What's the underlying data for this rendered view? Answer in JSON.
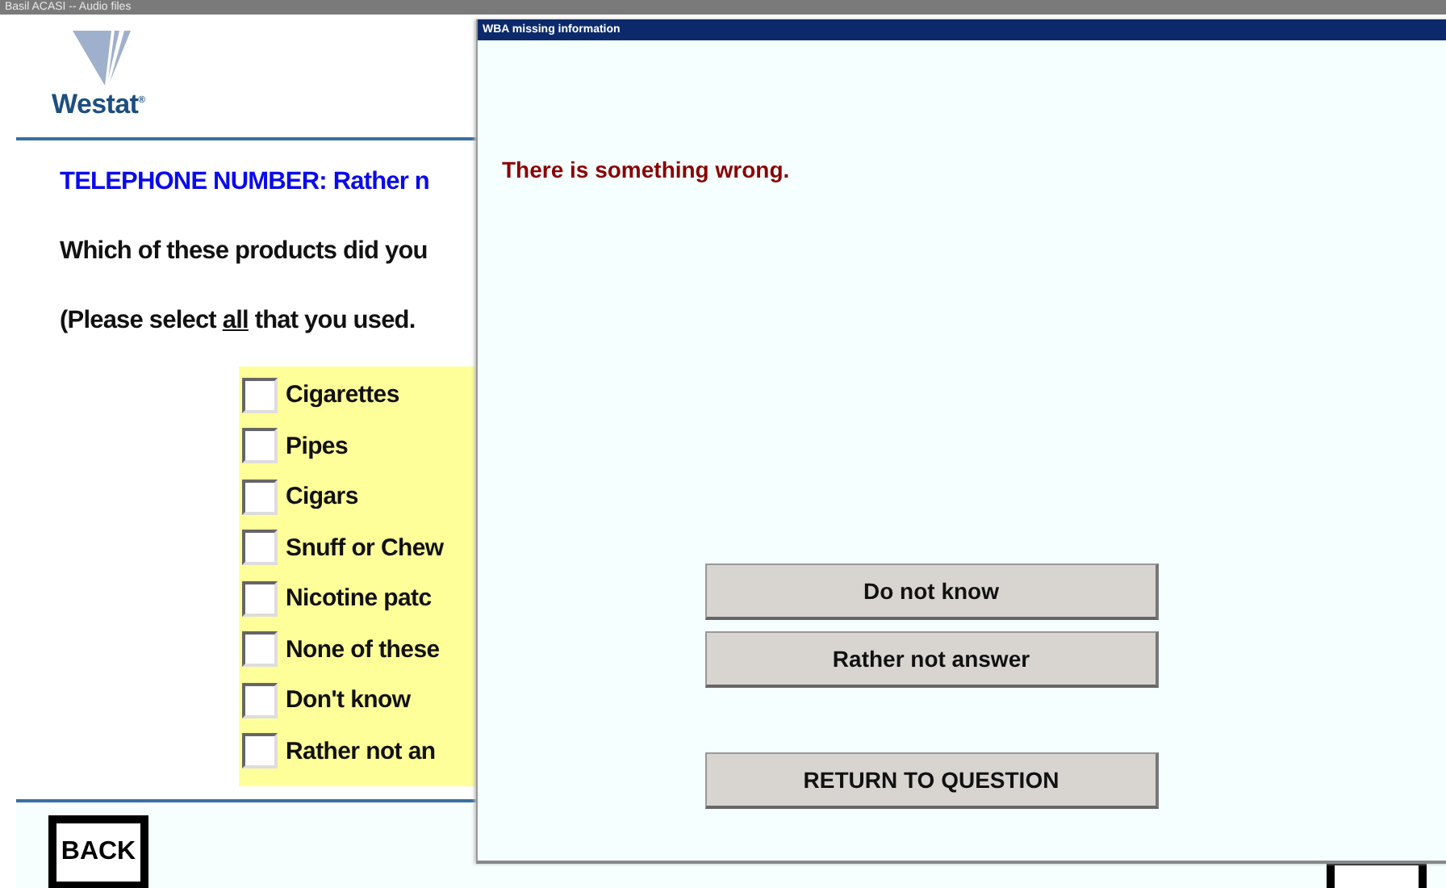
{
  "window": {
    "title": "Basil ACASI -- Audio files"
  },
  "logo": {
    "text": "Westat",
    "mark": "®"
  },
  "question": {
    "heading": "TELEPHONE NUMBER: Rather n",
    "text": "Which of these products did you",
    "instruction": "(Please select *all* that you used."
  },
  "options": [
    {
      "label": "Cigarettes",
      "checked": false
    },
    {
      "label": "Pipes",
      "checked": false
    },
    {
      "label": "Cigars",
      "checked": false
    },
    {
      "label": "Snuff or Chew",
      "checked": false
    },
    {
      "label": "Nicotine patc",
      "checked": false
    },
    {
      "label": "None of these",
      "checked": false
    },
    {
      "label": "Don't know",
      "checked": false
    },
    {
      "label": "Rather not an",
      "checked": false
    }
  ],
  "footer": {
    "back": "BACK"
  },
  "dialog": {
    "title": "WBA missing information",
    "message": "There is something wrong.",
    "buttons": [
      {
        "label": "Do not know",
        "kind": "answer"
      },
      {
        "label": "Rather not answer",
        "kind": "answer"
      },
      {
        "label": "RETURN TO QUESTION",
        "kind": "return"
      }
    ]
  }
}
